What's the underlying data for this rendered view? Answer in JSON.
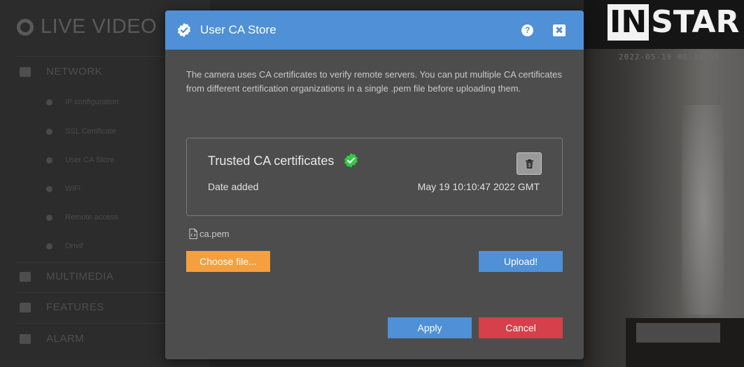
{
  "app": {
    "brand": "LIVE VIDEO",
    "nav": {
      "network": "NETWORK",
      "network_items": [
        "IP configuration",
        "SSL Certificate",
        "User CA Store",
        "WiFi",
        "Remote access",
        "Onvif"
      ],
      "multimedia": "MULTIMEDIA",
      "features": "FEATURES",
      "alarm": "ALARM"
    },
    "camera": {
      "logo_in": "IN",
      "logo_star": "STAR",
      "timestamp": "2022-05-19 06:18:55"
    }
  },
  "modal": {
    "title": "User CA Store",
    "help_label": "?",
    "close_label": "✖",
    "description": "The camera uses CA certificates to verify remote servers. You can put multiple CA certificates from different certification organizations in a single .pem file before uploading them.",
    "certificate": {
      "title": "Trusted CA certificates",
      "date_label": "Date added",
      "date_value": "May 19 10:10:47 2022 GMT"
    },
    "file_name": "ca.pem",
    "choose_label": "Choose file...",
    "upload_label": "Upload!",
    "apply_label": "Apply",
    "cancel_label": "Cancel"
  },
  "colors": {
    "header": "#4f90d6",
    "choose": "#f59f3e",
    "cancel": "#d6404a",
    "badge": "#2ecc40"
  }
}
